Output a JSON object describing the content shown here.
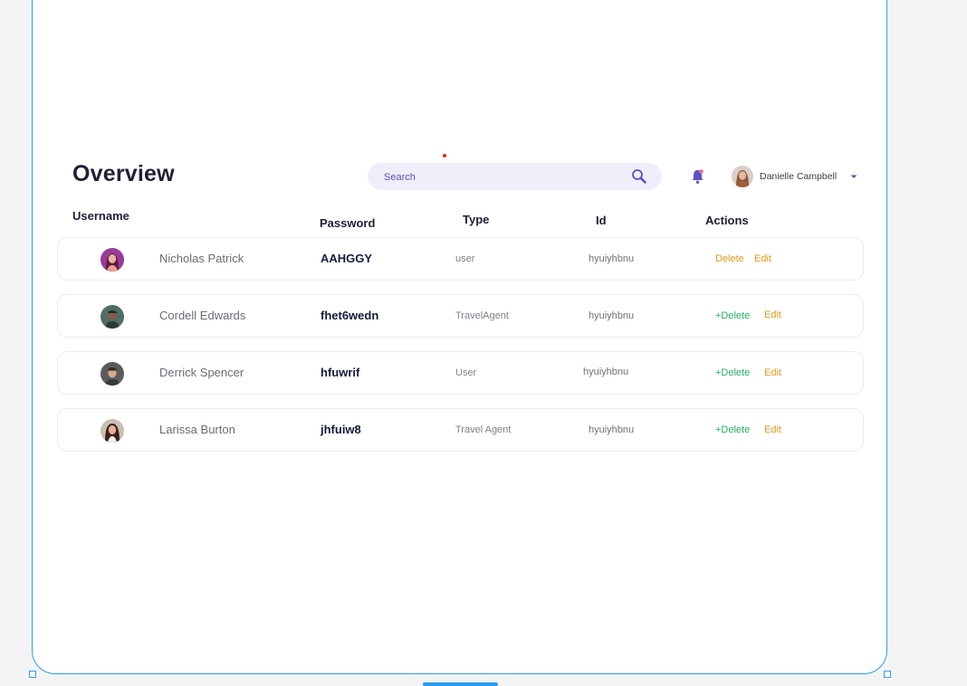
{
  "header": {
    "title": "Overview",
    "search_placeholder": "Search",
    "user_name": "Danielle Campbell"
  },
  "table": {
    "columns": [
      "Username",
      "Password",
      "Type",
      "Id",
      "Actions"
    ],
    "rows": [
      {
        "username": "Nicholas Patrick",
        "password": "AAHGGY",
        "type": "user",
        "id": "hyuiyhbnu",
        "delete_label": "Delete",
        "edit_label": "Edit",
        "delete_color": "#e59a1c"
      },
      {
        "username": "Cordell Edwards",
        "password": "fhet6wedn",
        "type": "TravelAgent",
        "id": "hyuiyhbnu",
        "delete_label": "+Delete",
        "edit_label": "Edit",
        "delete_color": "#27ae60"
      },
      {
        "username": "Derrick Spencer",
        "password": "hfuwrif",
        "type": "User",
        "id": "hyuiyhbnu",
        "delete_label": "+Delete",
        "edit_label": "Edit",
        "delete_color": "#27ae60"
      },
      {
        "username": "Larissa Burton",
        "password": "jhfuiw8",
        "type": "Travel Agent",
        "id": "hyuiyhbnu",
        "delete_label": "+Delete",
        "edit_label": "Edit",
        "delete_color": "#27ae60"
      }
    ]
  },
  "colors": {
    "frame_border": "#2d9cf0",
    "search_bg": "#efeefb",
    "accent": "#5a52c4",
    "edit": "#e59a1c",
    "delete_green": "#27ae60"
  }
}
